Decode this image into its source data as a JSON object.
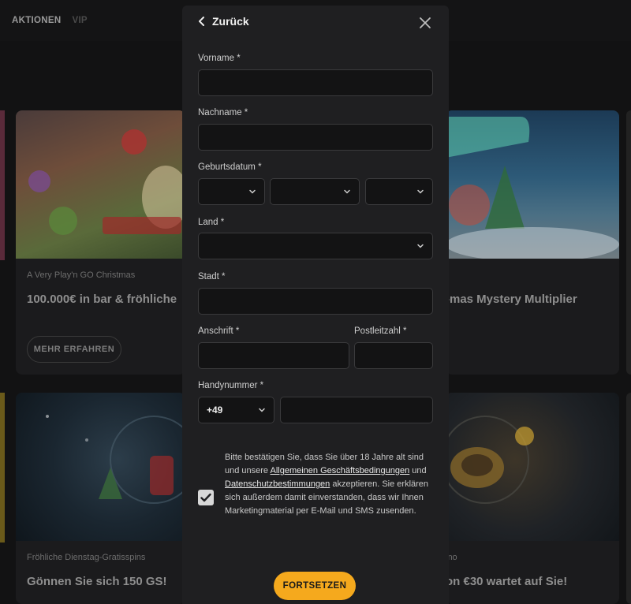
{
  "nav": {
    "items": [
      "AKTIONEN",
      "VIP"
    ]
  },
  "cards": [
    {
      "subtitle": "A Very Play'n GO Christmas",
      "title": "100.000€ in bar & fröhliche",
      "button": "MEHR ERFAHREN"
    },
    {
      "subtitle": "",
      "title": "-mas Mystery Multiplier"
    },
    {
      "subtitle": "Fröhliche Dienstag-Gratisspins",
      "title": "Gönnen Sie sich 150 GS!"
    },
    {
      "subtitle": "ino",
      "title": "on €30 wartet auf Sie!"
    }
  ],
  "modal": {
    "back_label": "Zurück",
    "first_name_label": "Vorname *",
    "last_name_label": "Nachname *",
    "birthdate_label": "Geburtsdatum *",
    "country_label": "Land *",
    "city_label": "Stadt *",
    "address_label": "Anschrift *",
    "postcode_label": "Postleitzahl *",
    "phone_label": "Handynummer *",
    "phone_prefix": "+49",
    "consent": {
      "part1": "Bitte bestätigen Sie, dass Sie über 18 Jahre alt sind und unsere ",
      "link_terms": "Allgemeinen Geschäftsbedingungen",
      "part2": " und ",
      "link_privacy": "Datenschutzbestimmungen",
      "part3": " akzeptieren. Sie erklären sich außerdem damit einverstanden, dass wir Ihnen Marketingmaterial per E-Mail und SMS zusenden."
    },
    "consent_checked": true,
    "continue_label": "FORTSETZEN"
  },
  "colors": {
    "accent": "#f5a91d",
    "modal_bg": "#1f1f21",
    "input_bg": "#131314"
  }
}
